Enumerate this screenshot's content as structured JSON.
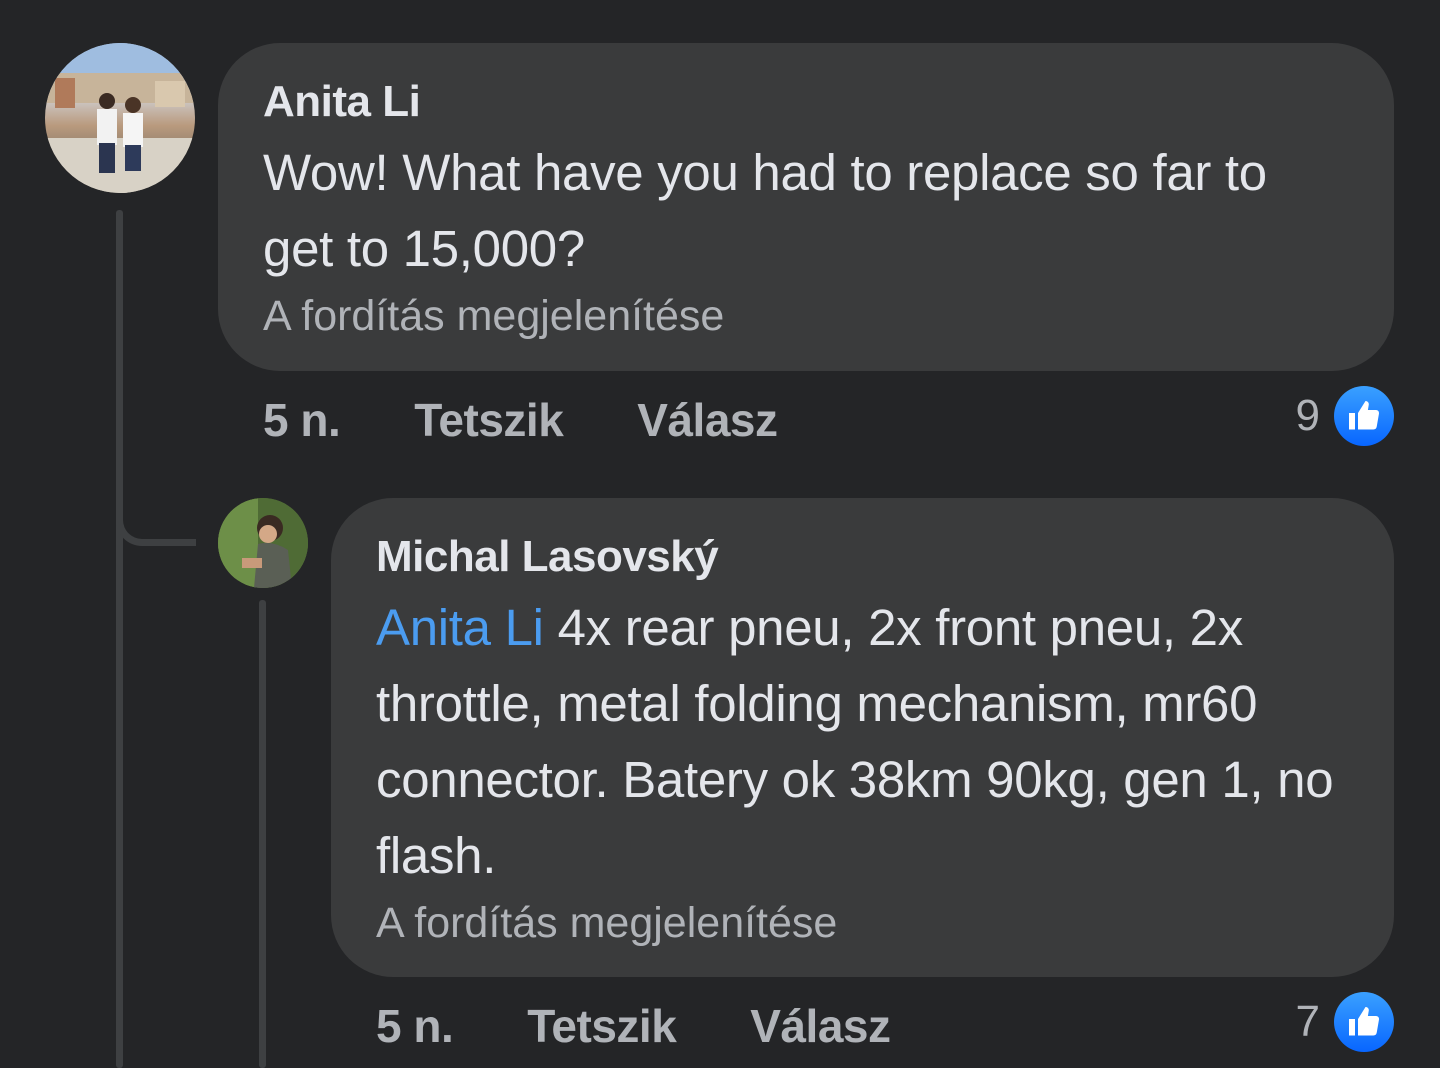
{
  "comments": [
    {
      "author": "Anita Li",
      "text": "Wow! What have you had to replace so far to get to 15,000?",
      "translate": "A fordítás megjelenítése",
      "time": "5 n.",
      "like_label": "Tetszik",
      "reply_label": "Válasz",
      "like_count": "9",
      "avatar_icon": "profile-photo"
    },
    {
      "author": "Michal Lasovský",
      "mention": "Anita Li",
      "text": " 4x rear pneu, 2x front pneu, 2x throttle, metal folding mechanism, mr60 connector. Batery ok 38km 90kg, gen 1, no flash.",
      "translate": "A fordítás megjelenítése",
      "time": "5 n.",
      "like_label": "Tetszik",
      "reply_label": "Válasz",
      "like_count": "7",
      "avatar_icon": "profile-photo"
    }
  ],
  "colors": {
    "background": "#242527",
    "bubble": "#3a3b3c",
    "mention": "#4b9cf0",
    "like": "#0866ff"
  },
  "icons": {
    "like": "thumbs-up-icon"
  }
}
